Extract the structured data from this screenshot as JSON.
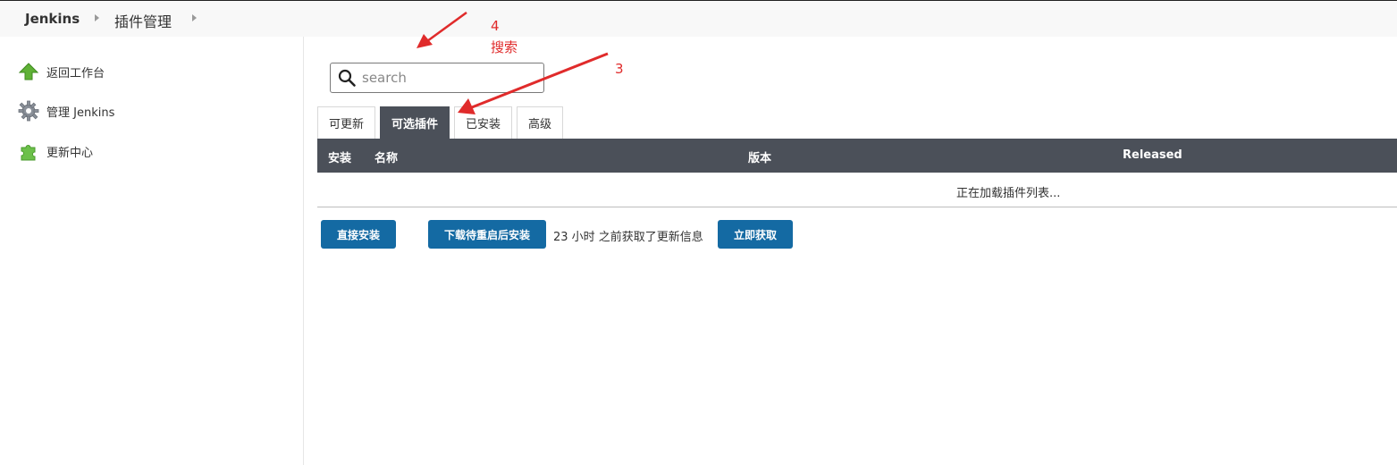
{
  "breadcrumb": {
    "root": "Jenkins",
    "current": "插件管理"
  },
  "sidebar": {
    "items": [
      {
        "label": "返回工作台",
        "icon": "up-arrow-icon"
      },
      {
        "label": "管理 Jenkins",
        "icon": "gear-icon"
      },
      {
        "label": "更新中心",
        "icon": "puzzle-icon"
      }
    ]
  },
  "search": {
    "placeholder": "search",
    "value": ""
  },
  "tabs": [
    {
      "label": "可更新",
      "active": false
    },
    {
      "label": "可选插件",
      "active": true
    },
    {
      "label": "已安装",
      "active": false
    },
    {
      "label": "高级",
      "active": false
    }
  ],
  "table": {
    "headers": [
      "安装",
      "名称",
      "版本",
      "Released"
    ],
    "loading_text": "正在加载插件列表..."
  },
  "actions": {
    "install_now": "直接安装",
    "download_restart": "下载待重启后安装",
    "update_info": "23 小时 之前获取了更新信息",
    "check_now": "立即获取"
  },
  "annotations": {
    "step4_number": "4",
    "step4_text": "搜索",
    "step3_number": "3",
    "color": "#e02b2b"
  },
  "colors": {
    "tab_active_bg": "#4b5059",
    "button_bg": "#146aa3",
    "header_bg": "#4b5059"
  }
}
